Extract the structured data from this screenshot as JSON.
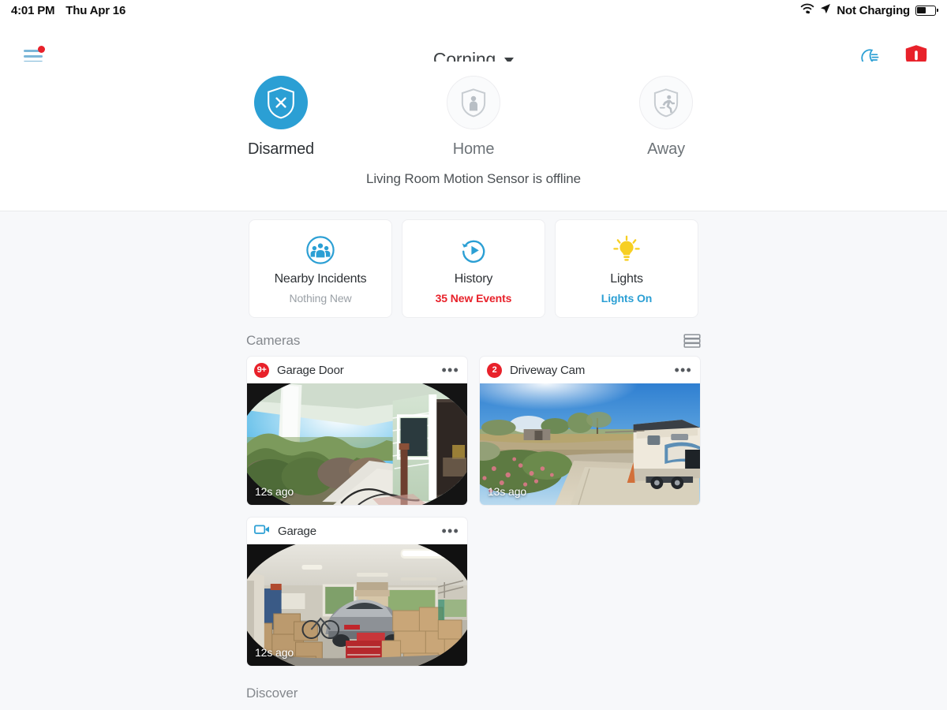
{
  "statusbar": {
    "time": "4:01 PM",
    "date": "Thu Apr 16",
    "wifi_icon": "wifi-icon",
    "location_icon": "location-arrow-icon",
    "battery_text": "Not Charging",
    "battery_icon": "battery-icon"
  },
  "nav": {
    "menu_icon": "hamburger-menu-icon",
    "menu_badge": "notification-dot",
    "title": "Corning",
    "caret_icon": "chevron-down-icon",
    "night_icon": "moon-night-mode-icon",
    "alert_icon": "shield-alert-icon"
  },
  "arm": {
    "modes": [
      {
        "label": "Disarmed",
        "icon": "shield-x-icon",
        "active": true
      },
      {
        "label": "Home",
        "icon": "shield-person-icon",
        "active": false
      },
      {
        "label": "Away",
        "icon": "shield-running-person-icon",
        "active": false
      }
    ],
    "status_text": "Living Room Motion Sensor is offline"
  },
  "quick_cards": [
    {
      "title": "Nearby Incidents",
      "subtitle": "Nothing New",
      "sub_style": "grey",
      "icon": "nearby-incidents-people-icon"
    },
    {
      "title": "History",
      "subtitle": "35 New Events",
      "sub_style": "red",
      "icon": "history-replay-icon"
    },
    {
      "title": "Lights",
      "subtitle": "Lights On",
      "sub_style": "blue",
      "icon": "lightbulb-icon"
    }
  ],
  "cameras": {
    "section_title": "Cameras",
    "layout_toggle_icon": "list-layout-toggle-icon",
    "items": [
      {
        "name": "Garage Door",
        "badge": "9+",
        "badge_type": "count",
        "timestamp": "12s ago",
        "menu_icon": "more-options-icon",
        "scene": "porch"
      },
      {
        "name": "Driveway Cam",
        "badge": "2",
        "badge_type": "count",
        "timestamp": "13s ago",
        "menu_icon": "more-options-icon",
        "scene": "driveway"
      },
      {
        "name": "Garage",
        "badge": "",
        "badge_type": "camera-icon",
        "timestamp": "12s ago",
        "menu_icon": "more-options-icon",
        "scene": "garage"
      }
    ]
  },
  "discover": {
    "title": "Discover"
  },
  "colors": {
    "accent_blue": "#2b9fd4",
    "alert_red": "#e8212a",
    "light_yellow": "#f7cf23",
    "page_bg": "#f7f8fa"
  }
}
